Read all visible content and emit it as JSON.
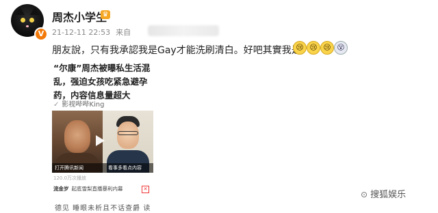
{
  "post": {
    "username": "周杰小学生",
    "level_badge": "V",
    "crown_badge": "♛",
    "timestamp": "21-12-11 22:53",
    "from_label": "来自",
    "text": "朋友說，只有我承認我是Gay才能洗刷清白。好吧其實我是",
    "emojis": [
      "😢",
      "😢",
      "😢",
      "😵"
    ]
  },
  "share_card": {
    "title": "“尔康”周杰被曝私生活混乱，强迫女孩吃紧急避孕药，内容信息量超大",
    "source_icon": "✓",
    "source": "影视哔哔King",
    "video_left_caption": "打开腾讯新闻",
    "video_right_caption": "看事多看点内容",
    "stats": "120.0万次播放",
    "comment_user": "流金岁",
    "comment_text": "起底雪梨直播暴利内幕",
    "close_icon": "✕",
    "bottom_text": "德见  睡眼未析且不话查爵  读"
  },
  "watermark": {
    "icon": "⊙",
    "text": "搜狐娱乐"
  }
}
